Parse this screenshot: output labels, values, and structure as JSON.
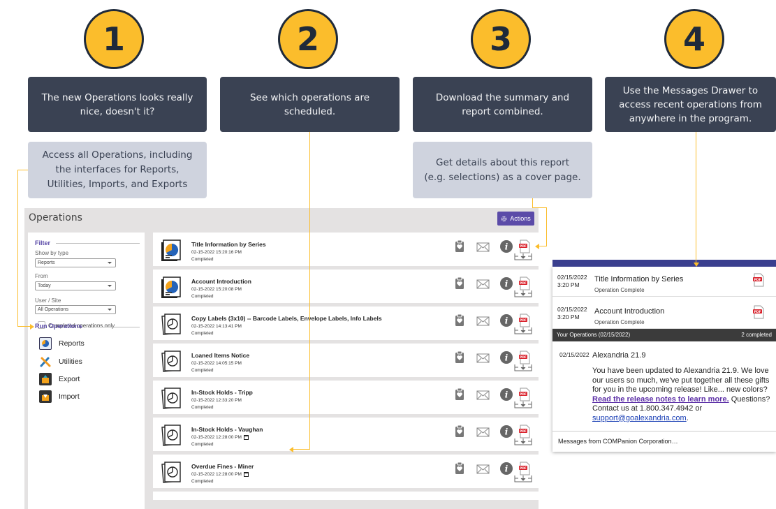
{
  "steps": [
    "1",
    "2",
    "3",
    "4"
  ],
  "callouts": {
    "c1": "The new Operations looks really nice, doesn't it?",
    "c2": "See which operations are scheduled.",
    "c3": "Download the summary and report combined.",
    "c4": "Use the Messages Drawer to access recent operations from anywhere in the program.",
    "c1b": "Access all Operations, including the interfaces for Reports, Utilities, Imports, and Exports",
    "c3b": "Get details about this report (e.g. selections) as a cover page."
  },
  "operations": {
    "title": "Operations",
    "actions_label": "Actions",
    "filter": {
      "heading": "Filter",
      "show_by_type_label": "Show by type",
      "show_by_type_value": "Reports",
      "from_label": "From",
      "from_value": "Today",
      "user_site_label": "User / Site",
      "user_site_value": "All Operations",
      "completed_only_label": "Completed operations only"
    },
    "run": {
      "heading": "Run Operations",
      "items": [
        "Reports",
        "Utilities",
        "Export",
        "Import"
      ]
    },
    "rows": [
      {
        "title": "Title Information by Series",
        "date": "02-15-2022 15:20:16 PM",
        "status": "Completed"
      },
      {
        "title": "Account Introduction",
        "date": "02-15-2022 15:20:08 PM",
        "status": "Completed"
      },
      {
        "title": "Copy Labels (3x10) -- Barcode Labels, Envelope Labels, Info Labels",
        "date": "02-15-2022 14:13:41 PM",
        "status": "Completed"
      },
      {
        "title": "Loaned Items Notice",
        "date": "02-15-2022 14:05:15 PM",
        "status": "Completed"
      },
      {
        "title": "In-Stock Holds - Tripp",
        "date": "02-15-2022 12:33:20 PM",
        "status": "Completed"
      },
      {
        "title": "In-Stock Holds - Vaughan",
        "date": "02-15-2022 12:28:00 PM",
        "status": "Completed"
      },
      {
        "title": "Overdue Fines - Miner",
        "date": "02-15-2022 12:28:00 PM",
        "status": "Completed"
      }
    ]
  },
  "drawer": {
    "messages": [
      {
        "date": "02/15/2022 3:20 PM",
        "title": "Title Information by Series",
        "sub": "Operation Complete"
      },
      {
        "date": "02/15/2022 3:20 PM",
        "title": "Account Introduction",
        "sub": "Operation Complete"
      }
    ],
    "bar_left": "Your Operations (02/15/2022)",
    "bar_right": "2 completed",
    "note": {
      "date": "02/15/2022",
      "title": "Alexandria 21.9",
      "body_1": "You have been updated to Alexandria 21.9. We love our users so much, we've put together all these gifts for you in the upcoming release! Like... new colors?",
      "link_1": "Read the release notes to learn more.",
      "body_2": " Questions? Contact us at 1.800.347.4942 or",
      "link_2": "support@goalexandria.com",
      "body_3": "."
    },
    "footer": "Messages from COMPanion Corporation…"
  },
  "colors": {
    "accent": "#fbbd2c",
    "dark": "#3a4253",
    "purple": "#5b4ba8"
  },
  "icons": [
    "pie-report-icon",
    "clipboard-icon",
    "mail-icon",
    "info-icon",
    "pdf-icon",
    "download-icon",
    "calendar-icon",
    "gear-icon"
  ]
}
